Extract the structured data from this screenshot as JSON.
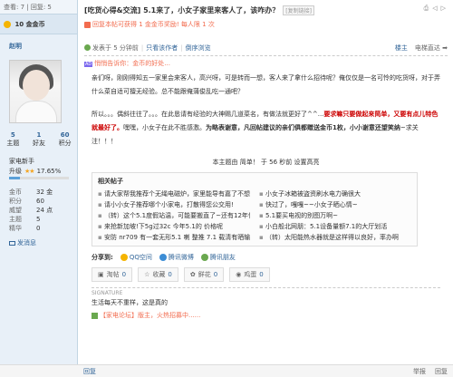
{
  "sidebar": {
    "stats_text": "查看: 7 | 回复: 5",
    "coins_label": "10 金金币",
    "username": "赵明",
    "counts": [
      {
        "num": "5",
        "label": "主题"
      },
      {
        "num": "1",
        "label": "好友"
      },
      {
        "num": "60",
        "label": "积分"
      }
    ],
    "rank": "家电新手",
    "level_label": "升级",
    "level_percent": "17.65%",
    "level_fraction": 0.1765,
    "info": [
      {
        "k": "金币",
        "v": "32 金"
      },
      {
        "k": "积分",
        "v": "60"
      },
      {
        "k": "威望",
        "v": "24 点"
      },
      {
        "k": "主题",
        "v": "5"
      },
      {
        "k": "精华",
        "v": "0"
      }
    ],
    "send_message": "发消息"
  },
  "header": {
    "title": "[吃货心得&交流] 5.1来了，小女子家里来客人了，该咋办？",
    "copy_link": "[复制链接]",
    "reward_text": "回复本帖可获得 1 金金币奖励! 每人限 1 次"
  },
  "post": {
    "posted_at": "发表于 5 分钟前",
    "only_author": "只看该作者",
    "reverse": "倒序浏览",
    "floor": "楼主",
    "jump": "电梯直达",
    "ad_tag": "AD",
    "ad_text": "悄悄告诉你：金币的好处...",
    "para1": "亲们呀，刚刚得知五一家里会来客人，高兴呀，可是转而一想，客人来了拿什么招待呢？俺仅仅是一名可怜的吃货呀，对于弄什么菜自适可擅无经验。总不能跟俺蒲俊乱吃一通吧？",
    "para2_a": "所以。。。偶斜往往了。。。在此恳请有经验的大神赐几道菜名，有做法就更好了^^...",
    "para2_b": "要求嘛只要做起来简单，又要有点儿特色就最好了。",
    "para2_c": "嘿嘿，小女子在此不胜感激。",
    "para2_d": "为略表谢意，凡回帖建议的亲们俱都赠送金币1枚，小小谢意还望笑纳",
    "para2_e": "~求关注！！！",
    "last_post": "本主题由 简单！ 于 56 秒前 设置高亮"
  },
  "related": {
    "heading": "相关帖子",
    "items": [
      "请大家帮我推荐个无绳电磁炉，家里能导有嘉了不想抛掷电",
      "小女子冰箱被盗资刷水电力确很大",
      "请小小女子推荐哪个小家电，打散得您公交用!",
      "快过了，嘎嘎~~小女子晒心情~",
      "（转）这个5.1度假站温，可能要搬直了~还有12年保价",
      "5.1要买电视的别图万啊~",
      "来抢新加坡!下5g过32c 今年5.1的 价格呢",
      "小白般北网朋：5.1设备量额7.1的大厅划活",
      "安防 nr709 有一套无形5.1 喇 整推 7.1 载清有晒输出一个对",
      "（转）太阳能热水器就是这样得以良好，率办啊"
    ]
  },
  "share": {
    "label": "分享到:",
    "services": [
      "QQ空间",
      "腾讯微博",
      "腾讯朋友"
    ]
  },
  "actions": [
    {
      "label": "淘帖",
      "count": "0"
    },
    {
      "label": "收藏",
      "count": "0"
    },
    {
      "label": "鲜花",
      "count": "0"
    },
    {
      "label": "鸡蛋",
      "count": "0"
    }
  ],
  "signature": {
    "label": "SIGNATURE",
    "text": "生活每天不重样，这是真的",
    "ad": "【家电论坛】版主，火热招募中......"
  },
  "bottombar": {
    "left": "回复",
    "right_items": [
      "举报",
      "回复"
    ]
  },
  "colors": {
    "sidebar_bg": "#e8f0f8",
    "accent_orange": "#f26c4f",
    "link_blue": "#336699"
  }
}
